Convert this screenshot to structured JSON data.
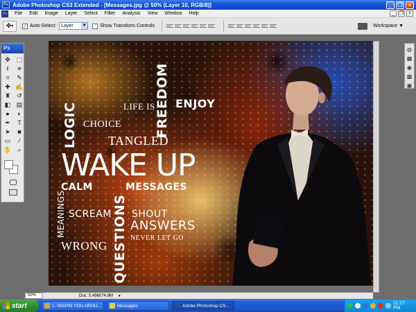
{
  "window": {
    "title": "Adobe Photoshop CS3 Extended - [Messages.jpg @ 50% (Layer 10, RGB/8)]",
    "app_icon": "Ps",
    "controls": [
      "minimize",
      "restore",
      "close"
    ]
  },
  "menu": {
    "items": [
      "File",
      "Edit",
      "Image",
      "Layer",
      "Select",
      "Filter",
      "Analysis",
      "View",
      "Window",
      "Help"
    ]
  },
  "options": {
    "auto_select_label": "Auto-Select:",
    "auto_select_checked": true,
    "auto_select_target": "Layer",
    "show_transform_label": "Show Transform Controls",
    "show_transform_checked": false,
    "workspace_label": "Workspace",
    "workspace_arrow": "▼"
  },
  "toolbox": {
    "logo": "Ps",
    "tools": [
      "move-icon",
      "marquee-icon",
      "lasso-icon",
      "magic-wand-icon",
      "crop-icon",
      "slice-icon",
      "healing-icon",
      "brush-icon",
      "stamp-icon",
      "history-brush-icon",
      "eraser-icon",
      "gradient-icon",
      "blur-icon",
      "dodge-icon",
      "pen-icon",
      "type-icon",
      "path-select-icon",
      "shape-icon",
      "notes-icon",
      "eyedropper-icon",
      "hand-icon",
      "zoom-icon"
    ],
    "foreground_color": "#ffffff",
    "background_color": "#ffffff"
  },
  "canvas": {
    "words": {
      "life_is": "LIFE IS",
      "freedom": "FREEDOM",
      "enjoy": "ENJOY",
      "logic": "LOGIC",
      "choice": "CHOICE",
      "tangled": "TANGLED",
      "wake_up": "WAKE UP",
      "calm": "CALM",
      "messages": "MESSAGES",
      "meanings": "MEANINGS",
      "scream": "SCREAM",
      "questions": "QUESTIONS",
      "shout": "SHOUT",
      "answers": "ANSWERS",
      "never_let_go": "NEVER LET GO",
      "wrong": "WRONG"
    }
  },
  "status": {
    "zoom": "50%",
    "doc_info": "Doc: 5.49M/74.8M",
    "arrow": "▸"
  },
  "taskbar": {
    "start_label": "start",
    "tasks": [
      {
        "label": "1. 05SPIN YOU AROU...",
        "icon_color": "#e0a040"
      },
      {
        "label": "Messages",
        "icon_color": "#f0c850"
      },
      {
        "label": "Adobe Photoshop CS...",
        "icon_color": "#2b4fa0"
      }
    ],
    "clock": "11:27 PM"
  }
}
